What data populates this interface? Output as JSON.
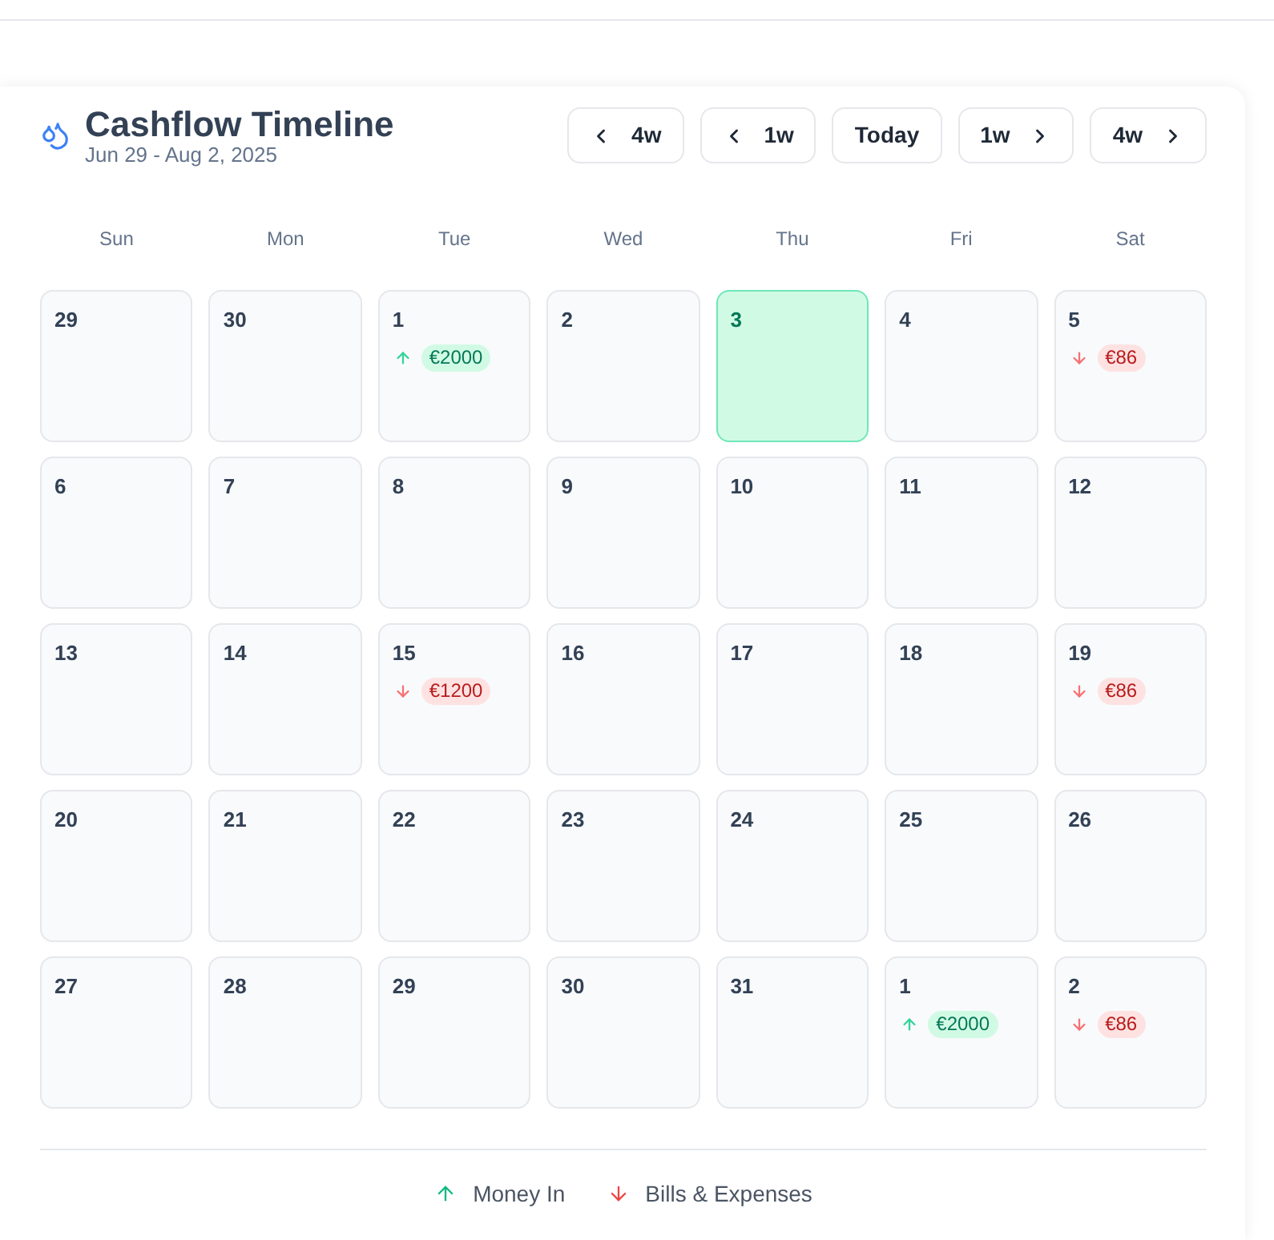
{
  "header": {
    "title": "Cashflow Timeline",
    "subtitle": "Jun 29 - Aug 2, 2025"
  },
  "nav_buttons": [
    {
      "label": "4w",
      "kind": "back"
    },
    {
      "label": "1w",
      "kind": "back"
    },
    {
      "label": "Today",
      "kind": "today"
    },
    {
      "label": "1w",
      "kind": "forward"
    },
    {
      "label": "4w",
      "kind": "forward"
    }
  ],
  "weekdays": [
    "Sun",
    "Mon",
    "Tue",
    "Wed",
    "Thu",
    "Fri",
    "Sat"
  ],
  "weeks": [
    [
      {
        "day": "29",
        "today": false
      },
      {
        "day": "30",
        "today": false
      },
      {
        "day": "1",
        "today": false,
        "transactions": [
          {
            "kind": "in",
            "amount": "€2000"
          }
        ]
      },
      {
        "day": "2",
        "today": false
      },
      {
        "day": "3",
        "today": true
      },
      {
        "day": "4",
        "today": false
      },
      {
        "day": "5",
        "today": false,
        "transactions": [
          {
            "kind": "out",
            "amount": "€86"
          }
        ]
      }
    ],
    [
      {
        "day": "6",
        "today": false
      },
      {
        "day": "7",
        "today": false
      },
      {
        "day": "8",
        "today": false
      },
      {
        "day": "9",
        "today": false
      },
      {
        "day": "10",
        "today": false
      },
      {
        "day": "11",
        "today": false
      },
      {
        "day": "12",
        "today": false
      }
    ],
    [
      {
        "day": "13",
        "today": false
      },
      {
        "day": "14",
        "today": false
      },
      {
        "day": "15",
        "today": false,
        "transactions": [
          {
            "kind": "out",
            "amount": "€1200"
          }
        ]
      },
      {
        "day": "16",
        "today": false
      },
      {
        "day": "17",
        "today": false
      },
      {
        "day": "18",
        "today": false
      },
      {
        "day": "19",
        "today": false,
        "transactions": [
          {
            "kind": "out",
            "amount": "€86"
          }
        ]
      }
    ],
    [
      {
        "day": "20",
        "today": false
      },
      {
        "day": "21",
        "today": false
      },
      {
        "day": "22",
        "today": false
      },
      {
        "day": "23",
        "today": false
      },
      {
        "day": "24",
        "today": false
      },
      {
        "day": "25",
        "today": false
      },
      {
        "day": "26",
        "today": false
      }
    ],
    [
      {
        "day": "27",
        "today": false
      },
      {
        "day": "28",
        "today": false
      },
      {
        "day": "29",
        "today": false
      },
      {
        "day": "30",
        "today": false
      },
      {
        "day": "31",
        "today": false
      },
      {
        "day": "1",
        "today": false,
        "transactions": [
          {
            "kind": "in",
            "amount": "€2000"
          }
        ]
      },
      {
        "day": "2",
        "today": false,
        "transactions": [
          {
            "kind": "out",
            "amount": "€86"
          }
        ]
      }
    ]
  ],
  "legend": [
    {
      "kind": "in",
      "label": "Money In"
    },
    {
      "kind": "out",
      "label": "Bills & Expenses"
    }
  ]
}
